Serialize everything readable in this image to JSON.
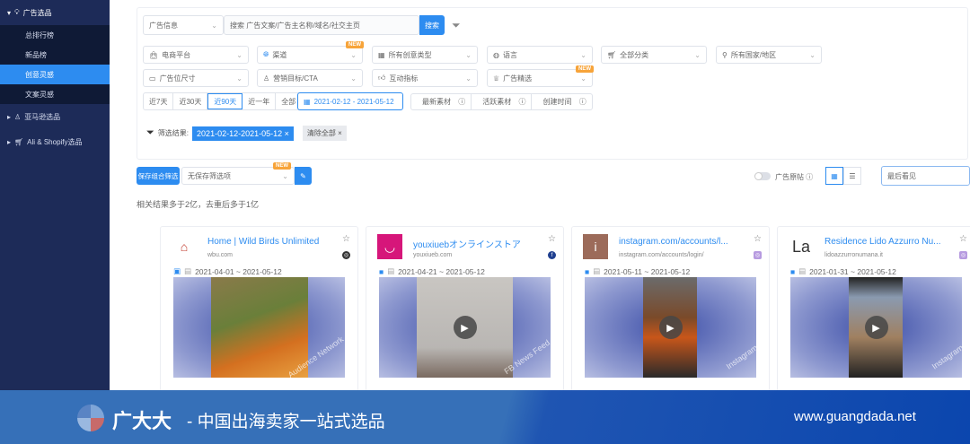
{
  "sidebar": {
    "section": "广告选品",
    "items": [
      "总排行榜",
      "新品榜",
      "创意灵感",
      "文案灵感"
    ],
    "active": "创意灵感",
    "amazon": "亚马逊选品",
    "shopify": "Ali & Shopify选品"
  },
  "search": {
    "type": "广告信息",
    "placeholder": "搜索 广告文案/广告主名称/域名/社交主页",
    "button": "搜索"
  },
  "filters": {
    "row1": [
      "电商平台",
      "渠道",
      "所有创意类型",
      "语言",
      "全部分类",
      "所有国家/地区"
    ],
    "row2": [
      "广告位尺寸",
      "营销目标/CTA",
      "互动指标",
      "广告精选"
    ],
    "new": "NEW"
  },
  "time": {
    "ranges": [
      "近7天",
      "近30天",
      "近90天",
      "近一年",
      "全部"
    ],
    "active": "近90天",
    "date_range": "2021-02-12 - 2021-05-12",
    "sorts": [
      "最新素材",
      "活跃素材",
      "创建时间"
    ]
  },
  "result": {
    "label": "筛选结果:",
    "tag": "2021-02-12-2021-05-12 ×",
    "clear": "清除全部 ×"
  },
  "toolbar": {
    "save": "保存组合筛选",
    "saved_placeholder": "无保存筛选项",
    "new": "NEW",
    "original": "广告原帖",
    "sort": "最后看见"
  },
  "summary": "相关结果多于2亿，去重后多于1亿",
  "cards": [
    {
      "title": "Home | Wild Birds Unlimited",
      "domain": "wbu.com",
      "date": "2021-04-01 ~ 2021-05-12",
      "watermark": "Audience Network",
      "logo": "",
      "media": "image"
    },
    {
      "title": "youxiuebオンラインストア",
      "domain": "youxiueb.com",
      "date": "2021-04-21 ~ 2021-05-12",
      "watermark": "FB News Feed",
      "logo": "",
      "media": "video"
    },
    {
      "title": "instagram.com/accounts/l...",
      "domain": "instagram.com/accounts/login/",
      "date": "2021-05-11 ~ 2021-05-12",
      "watermark": "Instagram",
      "logo": "i",
      "media": "video"
    },
    {
      "title": "Residence Lido Azzurro Nu...",
      "domain": "lidoazzurronumana.it",
      "date": "2021-01-31 ~ 2021-05-12",
      "watermark": "Instagram",
      "logo": "La",
      "media": "video"
    }
  ],
  "footer": {
    "brand": "广大大",
    "slogan": "- 中国出海卖家一站式选品",
    "url": "www.guangdada.net"
  }
}
